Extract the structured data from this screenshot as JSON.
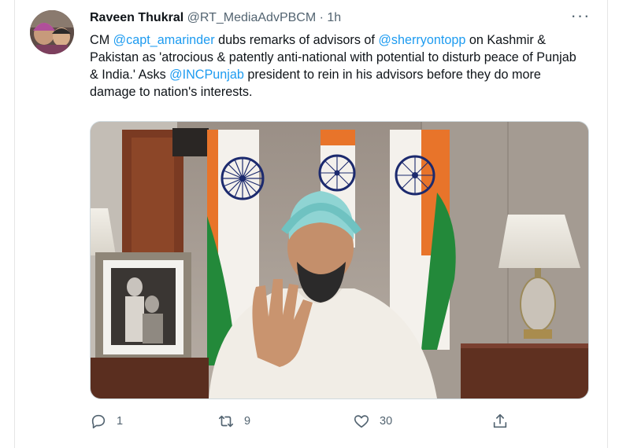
{
  "tweet": {
    "author_name": "Raveen Thukral",
    "handle": "@RT_MediaAdvPBCM",
    "separator": "·",
    "time": "1h",
    "more_label": "···",
    "text_segments": [
      {
        "text": "CM ",
        "mention": false
      },
      {
        "text": "@capt_amarinder",
        "mention": true
      },
      {
        "text": " dubs remarks of advisors of ",
        "mention": false
      },
      {
        "text": "@sherryontopp",
        "mention": true
      },
      {
        "text": " on Kashmir & Pakistan as 'atrocious & patently anti-national with potential to disturb peace of Punjab & India.'  Asks ",
        "mention": false
      },
      {
        "text": "@INCPunjab",
        "mention": true
      },
      {
        "text": " president to rein in his advisors before they do more damage to nation's interests.",
        "mention": false
      }
    ]
  },
  "actions": {
    "reply": {
      "icon": "reply-icon",
      "count": "1"
    },
    "retweet": {
      "icon": "retweet-icon",
      "count": "9"
    },
    "like": {
      "icon": "heart-icon",
      "count": "30"
    },
    "share": {
      "icon": "share-icon",
      "count": ""
    }
  },
  "colors": {
    "link": "#1d9bf0",
    "secondary_text": "#536471",
    "primary_text": "#0f1419",
    "saffron": "#e8742a",
    "flag_green": "#23893a",
    "chakra_navy": "#1c2a6e"
  }
}
